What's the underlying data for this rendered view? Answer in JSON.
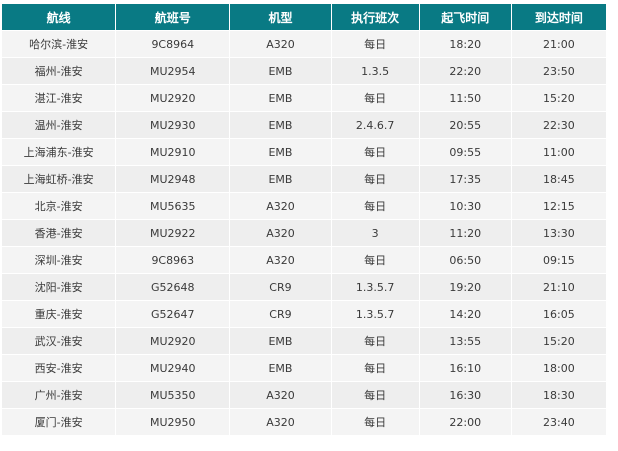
{
  "table": {
    "headers": {
      "route": "航线",
      "flight": "航班号",
      "aircraft": "机型",
      "days": "执行班次",
      "departure": "起飞时间",
      "arrival": "到达时间"
    },
    "rows": [
      {
        "route": "哈尔滨-淮安",
        "flight": "9C8964",
        "aircraft": "A320",
        "days": "每日",
        "departure": "18:20",
        "arrival": "21:00"
      },
      {
        "route": "福州-淮安",
        "flight": "MU2954",
        "aircraft": "EMB",
        "days": "1.3.5",
        "departure": "22:20",
        "arrival": "23:50"
      },
      {
        "route": "湛江-淮安",
        "flight": "MU2920",
        "aircraft": "EMB",
        "days": "每日",
        "departure": "11:50",
        "arrival": "15:20"
      },
      {
        "route": "温州-淮安",
        "flight": "MU2930",
        "aircraft": "EMB",
        "days": "2.4.6.7",
        "departure": "20:55",
        "arrival": "22:30"
      },
      {
        "route": "上海浦东-淮安",
        "flight": "MU2910",
        "aircraft": "EMB",
        "days": "每日",
        "departure": "09:55",
        "arrival": "11:00"
      },
      {
        "route": "上海虹桥-淮安",
        "flight": "MU2948",
        "aircraft": "EMB",
        "days": "每日",
        "departure": "17:35",
        "arrival": "18:45"
      },
      {
        "route": "北京-淮安",
        "flight": "MU5635",
        "aircraft": "A320",
        "days": "每日",
        "departure": "10:30",
        "arrival": "12:15"
      },
      {
        "route": "香港-淮安",
        "flight": "MU2922",
        "aircraft": "A320",
        "days": "3",
        "departure": "11:20",
        "arrival": "13:30"
      },
      {
        "route": "深圳-淮安",
        "flight": "9C8963",
        "aircraft": "A320",
        "days": "每日",
        "departure": "06:50",
        "arrival": "09:15"
      },
      {
        "route": "沈阳-淮安",
        "flight": "G52648",
        "aircraft": "CR9",
        "days": "1.3.5.7",
        "departure": "19:20",
        "arrival": "21:10"
      },
      {
        "route": "重庆-淮安",
        "flight": "G52647",
        "aircraft": "CR9",
        "days": "1.3.5.7",
        "departure": "14:20",
        "arrival": "16:05"
      },
      {
        "route": "武汉-淮安",
        "flight": "MU2920",
        "aircraft": "EMB",
        "days": "每日",
        "departure": "13:55",
        "arrival": "15:20"
      },
      {
        "route": "西安-淮安",
        "flight": "MU2940",
        "aircraft": "EMB",
        "days": "每日",
        "departure": "16:10",
        "arrival": "18:00"
      },
      {
        "route": "广州-淮安",
        "flight": "MU5350",
        "aircraft": "A320",
        "days": "每日",
        "departure": "16:30",
        "arrival": "18:30"
      },
      {
        "route": "厦门-淮安",
        "flight": "MU2950",
        "aircraft": "A320",
        "days": "每日",
        "departure": "22:00",
        "arrival": "23:40"
      }
    ]
  },
  "colors": {
    "header_background": "#097a84",
    "header_text": "#ffffff",
    "row_background": "#f0f0f0",
    "cell_text": "#3a3a3a"
  }
}
